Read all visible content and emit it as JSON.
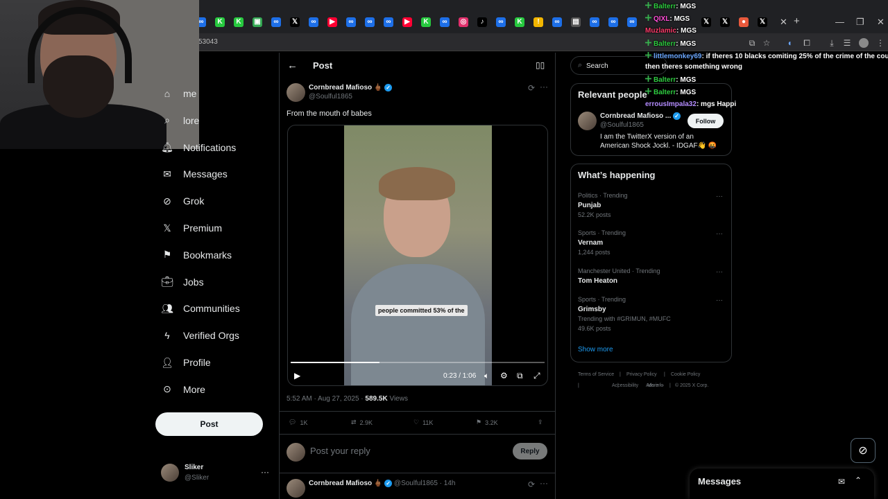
{
  "browser": {
    "url_fragment": "53043",
    "tab_icons": [
      {
        "glyph": "∞",
        "color": "#1d6fe8"
      },
      {
        "glyph": "K",
        "color": "#27c93f"
      },
      {
        "glyph": "K",
        "color": "#27c93f"
      },
      {
        "glyph": "▣",
        "color": "#34a853"
      },
      {
        "glyph": "∞",
        "color": "#1d6fe8"
      },
      {
        "glyph": "𝕏",
        "color": "#000000"
      },
      {
        "glyph": "∞",
        "color": "#1d6fe8"
      },
      {
        "glyph": "▶",
        "color": "#ff0033"
      },
      {
        "glyph": "∞",
        "color": "#1d6fe8"
      },
      {
        "glyph": "∞",
        "color": "#1d6fe8"
      },
      {
        "glyph": "∞",
        "color": "#1d6fe8"
      },
      {
        "glyph": "▶",
        "color": "#ff0033"
      },
      {
        "glyph": "K",
        "color": "#27c93f"
      },
      {
        "glyph": "∞",
        "color": "#1d6fe8"
      },
      {
        "glyph": "◎",
        "color": "#e1306c"
      },
      {
        "glyph": "♪",
        "color": "#000000"
      },
      {
        "glyph": "∞",
        "color": "#1d6fe8"
      },
      {
        "glyph": "K",
        "color": "#27c93f"
      },
      {
        "glyph": "!",
        "color": "#f2b600"
      },
      {
        "glyph": "∞",
        "color": "#1d6fe8"
      },
      {
        "glyph": "▤",
        "color": "#555555"
      },
      {
        "glyph": "∞",
        "color": "#1d6fe8"
      },
      {
        "glyph": "∞",
        "color": "#1d6fe8"
      },
      {
        "glyph": "∞",
        "color": "#1d6fe8"
      }
    ]
  },
  "chat": [
    {
      "user": "Balterr",
      "user_color": "#2ecc40",
      "text": ": MGS",
      "badge": true
    },
    {
      "user": "QIXL",
      "user_color": "#ff4fd8",
      "text": ": MGS",
      "badge": true
    },
    {
      "user": "Muzlamic",
      "user_color": "#ff3b6b",
      "text": ": MGS",
      "badge": false
    },
    {
      "user": "Balterr",
      "user_color": "#2ecc40",
      "text": ": MGS",
      "badge": true
    },
    {
      "user": "littlemonkey69",
      "user_color": "#6aa7ff",
      "text": ": if theres 10 blacks comiting 25% of the crime of the cou",
      "badge": true
    },
    {
      "user": "",
      "user_color": "#ffffff",
      "text": "then theres something wrong",
      "badge": false
    },
    {
      "user": "Balterr",
      "user_color": "#2ecc40",
      "text": ": MGS",
      "badge": true
    },
    {
      "user": "Balterr",
      "user_color": "#2ecc40",
      "text": ": MGS",
      "badge": true
    },
    {
      "user": "errousImpala32",
      "user_color": "#b48cff",
      "text": ": mgs Happi",
      "badge": false
    }
  ],
  "nav": {
    "items": [
      {
        "label": "me",
        "icon": "home-icon"
      },
      {
        "label": "lore",
        "icon": "explore-icon"
      },
      {
        "label": "Notifications",
        "icon": "bell-icon"
      },
      {
        "label": "Messages",
        "icon": "mail-icon"
      },
      {
        "label": "Grok",
        "icon": "grok-icon"
      },
      {
        "label": "Premium",
        "icon": "x-logo-icon"
      },
      {
        "label": "Bookmarks",
        "icon": "bookmark-icon"
      },
      {
        "label": "Jobs",
        "icon": "briefcase-icon"
      },
      {
        "label": "Communities",
        "icon": "people-icon"
      },
      {
        "label": "Verified Orgs",
        "icon": "lightning-icon"
      },
      {
        "label": "Profile",
        "icon": "person-icon"
      },
      {
        "label": "More",
        "icon": "more-circle-icon"
      }
    ],
    "post_label": "Post",
    "account_name": "Sliker",
    "account_handle": "@Sliker"
  },
  "post": {
    "header_title": "Post",
    "author_name": "Cornbread Mafioso 🖕🏾",
    "author_handle": "@Soulful1865",
    "text": "From the mouth of babes",
    "video_caption": "people committed 53% of the",
    "video_time": "0:23 / 1:06",
    "video_progress": 0.35,
    "timestamp": "5:52 AM · Aug 27, 2025 · ",
    "views_count": "589.5K",
    "views_label": " Views",
    "replies": "1K",
    "reposts": "2.9K",
    "likes": "11K",
    "bookmarks": "3.2K",
    "reply_placeholder": "Post your reply",
    "reply_button": "Reply",
    "reply_author": "Cornbread Mafioso 🖕🏾",
    "reply_handle": "@Soulful1865 · 14h"
  },
  "sidebar": {
    "search_placeholder": "Search",
    "relevant_title": "Relevant people",
    "person_name": "Cornbread Mafioso ...",
    "person_handle": "@Soulful1865",
    "person_bio_line1": "I am the TwitterX version of an",
    "person_bio_line2": "American Shock Jockl. - IDGAF👋 🤬",
    "follow_label": "Follow",
    "happening_title": "What’s happening",
    "trends": [
      {
        "category": "Politics · Trending",
        "name": "Punjab",
        "count": "52.2K posts",
        "with": ""
      },
      {
        "category": "Sports · Trending",
        "name": "Vernam",
        "count": "1,244 posts",
        "with": ""
      },
      {
        "category": "Manchester United · Trending",
        "name": "Tom Heaton",
        "count": "",
        "with": ""
      },
      {
        "category": "Sports · Trending",
        "name": "Grimsby",
        "count": "49.6K posts",
        "with": "Trending with #GRIMUN, #MUFC"
      }
    ],
    "show_more": "Show more",
    "footer": [
      "Terms of Service",
      "|",
      "Privacy Policy",
      "|",
      "Cookie Policy",
      "|",
      "Accessibility",
      "|",
      "Ads info",
      "|",
      "More ···",
      "© 2025 X Corp."
    ],
    "messages_label": "Messages"
  }
}
